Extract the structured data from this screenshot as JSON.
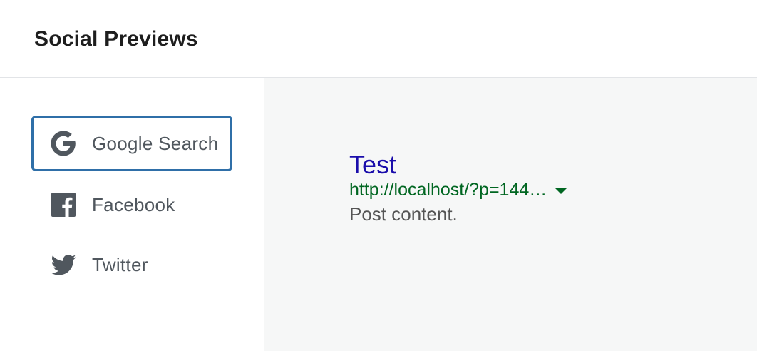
{
  "header": {
    "title": "Social Previews"
  },
  "sidebar": {
    "services": [
      {
        "label": "Google Search",
        "icon": "google-icon",
        "selected": true
      },
      {
        "label": "Facebook",
        "icon": "facebook-icon",
        "selected": false
      },
      {
        "label": "Twitter",
        "icon": "twitter-icon",
        "selected": false
      }
    ]
  },
  "preview": {
    "title": "Test",
    "url": "http://localhost/?p=144…",
    "description": "Post content."
  },
  "colors": {
    "selected_border": "#2f6fa8",
    "icon": "#50575e",
    "preview_bg": "#f6f7f7",
    "link_title": "#1a0dab",
    "link_url": "#006621",
    "description": "#545454"
  }
}
